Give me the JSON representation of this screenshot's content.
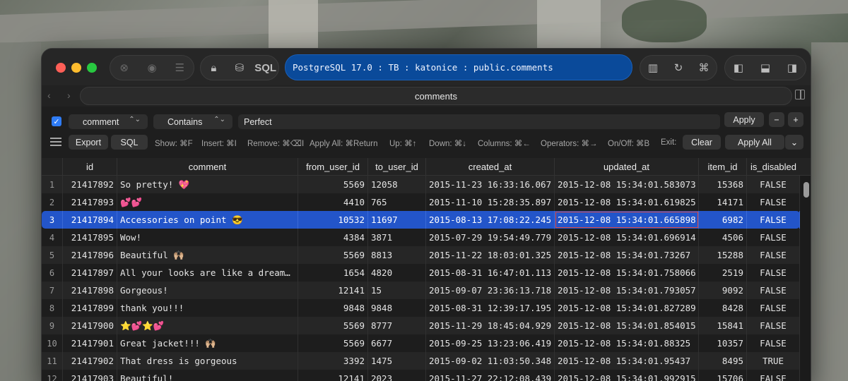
{
  "window": {
    "connection": "PostgreSQL 17.0 : TB : katonice : public.comments",
    "sql_label": "SQL"
  },
  "nav": {
    "table_name": "comments"
  },
  "filter": {
    "enabled": true,
    "column": "comment",
    "operator": "Contains",
    "value": "Perfect",
    "apply_label": "Apply",
    "minus_label": "−",
    "plus_label": "+"
  },
  "toolbar": {
    "export_label": "Export",
    "sql_label": "SQL",
    "hints": [
      "Show: ⌘F",
      "Insert: ⌘I",
      "Remove: ⌘⌫I",
      "Apply All: ⌘Return",
      "Up: ⌘↑",
      "Down: ⌘↓",
      "Columns: ⌘←",
      "Operators: ⌘→",
      "On/Off: ⌘B",
      "Exit:"
    ],
    "clear_label": "Clear",
    "apply_all_label": "Apply All"
  },
  "table": {
    "columns": [
      "id",
      "comment",
      "from_user_id",
      "to_user_id",
      "created_at",
      "updated_at",
      "item_id",
      "is_disabled"
    ],
    "selected_row": 3,
    "rows": [
      [
        "1",
        "21417892",
        "So pretty! 💖",
        "5569",
        "12058",
        "2015-11-23 16:33:16.067",
        "2015-12-08 15:34:01.583073",
        "15368",
        "FALSE"
      ],
      [
        "2",
        "21417893",
        "💕💕",
        "4410",
        "765",
        "2015-11-10 15:28:35.897",
        "2015-12-08 15:34:01.619825",
        "14171",
        "FALSE"
      ],
      [
        "3",
        "21417894",
        "Accessories on point 😎",
        "10532",
        "11697",
        "2015-08-13 17:08:22.245",
        "2015-12-08 15:34:01.665898",
        "6982",
        "FALSE"
      ],
      [
        "4",
        "21417895",
        "Wow!",
        "4384",
        "3871",
        "2015-07-29 19:54:49.779",
        "2015-12-08 15:34:01.696914",
        "4506",
        "FALSE"
      ],
      [
        "5",
        "21417896",
        "Beautiful 🙌🏼",
        "5569",
        "8813",
        "2015-11-22 18:03:01.325",
        "2015-12-08 15:34:01.73267",
        "15288",
        "FALSE"
      ],
      [
        "6",
        "21417897",
        "All your looks are like a dream…",
        "1654",
        "4820",
        "2015-08-31 16:47:01.113",
        "2015-12-08 15:34:01.758066",
        "2519",
        "FALSE"
      ],
      [
        "7",
        "21417898",
        "Gorgeous!",
        "12141",
        "15",
        "2015-09-07 23:36:13.718",
        "2015-12-08 15:34:01.793057",
        "9092",
        "FALSE"
      ],
      [
        "8",
        "21417899",
        "thank you!!!",
        "9848",
        "9848",
        "2015-08-31 12:39:17.195",
        "2015-12-08 15:34:01.827289",
        "8428",
        "FALSE"
      ],
      [
        "9",
        "21417900",
        "⭐️💕⭐️💕",
        "5569",
        "8777",
        "2015-11-29 18:45:04.929",
        "2015-12-08 15:34:01.854015",
        "15841",
        "FALSE"
      ],
      [
        "10",
        "21417901",
        "Great jacket!!! 🙌🏼",
        "5569",
        "6677",
        "2015-09-25 13:23:06.419",
        "2015-12-08 15:34:01.88325",
        "10357",
        "FALSE"
      ],
      [
        "11",
        "21417902",
        "That dress is gorgeous",
        "3392",
        "1475",
        "2015-09-02 11:03:50.348",
        "2015-12-08 15:34:01.95437",
        "8495",
        "TRUE"
      ],
      [
        "12",
        "21417903",
        "Beautiful!",
        "12141",
        "2023",
        "2015-11-27 22:12:08.439",
        "2015-12-08 15:34:01.992915",
        "15706",
        "FALSE"
      ]
    ]
  }
}
